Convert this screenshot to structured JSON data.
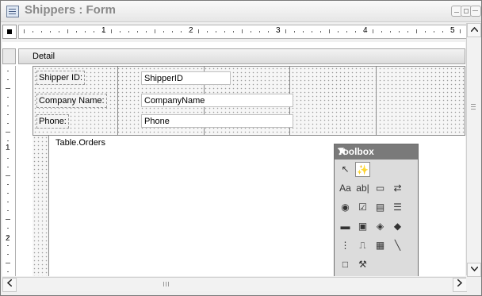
{
  "window": {
    "title": "Shippers : Form"
  },
  "ruler": {
    "numbers": [
      "1",
      "2",
      "3",
      "4",
      "5"
    ]
  },
  "vruler": {
    "numbers": [
      "1",
      "2"
    ]
  },
  "section": {
    "label": "Detail"
  },
  "controls": [
    {
      "label": "Shipper ID:",
      "field": "ShipperID"
    },
    {
      "label": "Company Name:",
      "field": "CompanyName"
    },
    {
      "label": "Phone:",
      "field": "Phone"
    }
  ],
  "subform": {
    "label": "Table.Orders"
  },
  "toolbox": {
    "title": "Toolbox",
    "tools": [
      "select-objects-icon",
      "control-wizards-icon",
      "label-icon",
      "text-box-icon",
      "option-group-icon",
      "toggle-button-icon",
      "option-button-icon",
      "check-box-icon",
      "combo-box-icon",
      "list-box-icon",
      "command-button-icon",
      "image-icon",
      "unbound-object-frame-icon",
      "bound-object-frame-icon",
      "page-break-icon",
      "tab-control-icon",
      "subform-icon",
      "line-icon",
      "rectangle-icon",
      "more-controls-icon"
    ]
  },
  "scroll": {
    "hgrip": "III"
  }
}
